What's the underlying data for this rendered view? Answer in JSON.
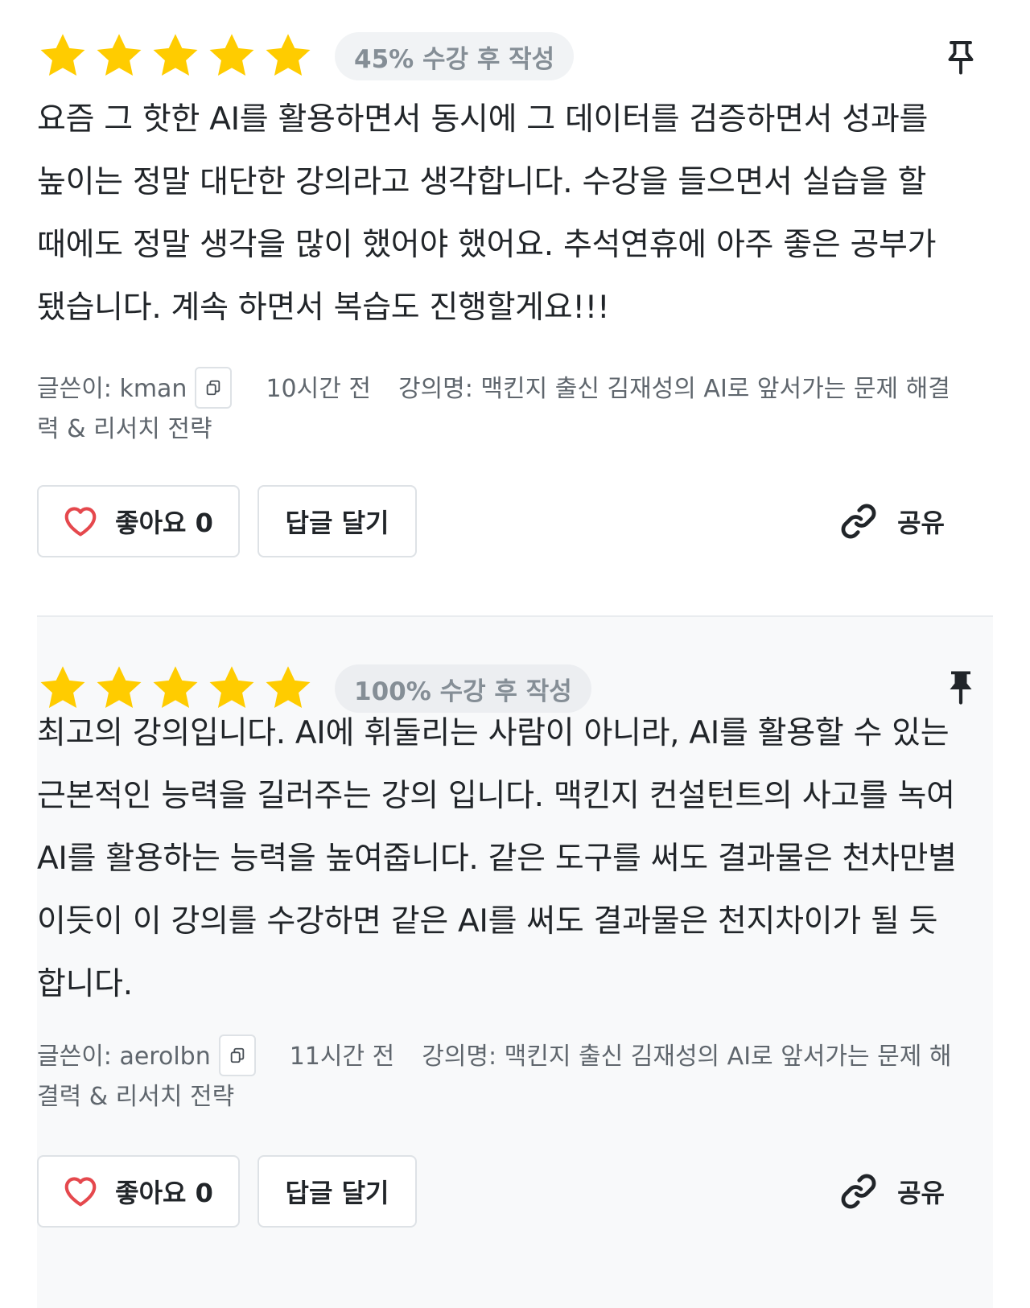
{
  "reviews": [
    {
      "rating": 5,
      "progress_badge": "45% 수강 후 작성",
      "pinned": false,
      "body": "요즘 그 핫한 AI를 활용하면서 동시에 그 데이터를 검증하면서 성과를 높이는 정말 대단한 강의라고 생각합니다. 수강을 들으면서 실습을 할 때에도 정말 생각을 많이 했어야 했어요. 추석연휴에 아주 좋은 공부가 됐습니다. 계속 하면서 복습도 진행할게요!!!",
      "author": "글쓴이: kman",
      "time": "10시간 전",
      "course": "강의명: 맥킨지 출신 김재성의 AI로 앞서가는 문제 해결력 & 리서치 전략",
      "like_label": "좋아요 0",
      "reply_label": "답글 달기",
      "share_label": "공유"
    },
    {
      "rating": 5,
      "progress_badge": "100% 수강 후 작성",
      "pinned": true,
      "body": "최고의 강의입니다. AI에 휘둘리는 사람이 아니라, AI를 활용할 수 있는 근본적인 능력을 길러주는 강의 입니다. 맥킨지 컨설턴트의 사고를 녹여 AI를 활용하는 능력을 높여줍니다. 같은 도구를 써도 결과물은 천차만별 이듯이 이 강의를 수강하면 같은 AI를 써도 결과물은 천지차이가 될 듯 합니다.",
      "author": "글쓴이: aerolbn",
      "time": "11시간 전",
      "course": "강의명: 맥킨지 출신 김재성의 AI로 앞서가는 문제 해결력 & 리서치 전략",
      "like_label": "좋아요 0",
      "reply_label": "답글 달기",
      "share_label": "공유"
    }
  ],
  "colors": {
    "star": "#FFCC00",
    "heart": "#E5484D",
    "badge_text": "#858E96",
    "meta_text": "#5F666D"
  },
  "icons": {
    "rating": "star-icon",
    "pin_outline": "pin-outline-icon",
    "pin_filled": "pin-filled-icon",
    "copy": "copy-icon",
    "like": "heart-icon",
    "share": "link-icon"
  }
}
